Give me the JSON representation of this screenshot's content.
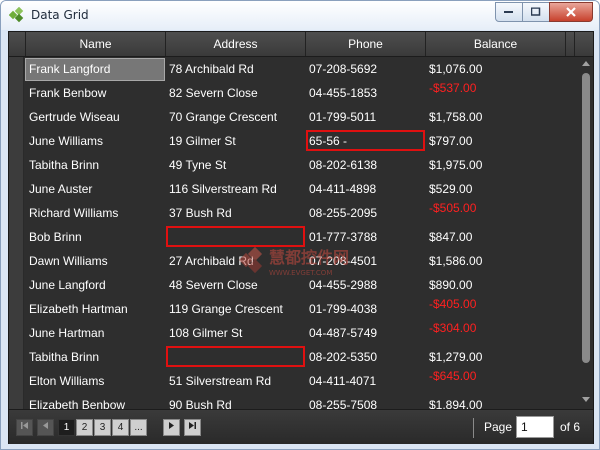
{
  "window": {
    "title": "Data Grid"
  },
  "grid": {
    "columns": [
      {
        "label": "Name"
      },
      {
        "label": "Address"
      },
      {
        "label": "Phone"
      },
      {
        "label": "Balance"
      }
    ],
    "rows": [
      {
        "name": "Frank Langford",
        "address": "78 Archibald Rd",
        "phone": "07-208-5692",
        "balance": "$1,076.00",
        "negative": false
      },
      {
        "name": "Frank Benbow",
        "address": "82 Severn Close",
        "phone": "04-455-1853",
        "balance": "-$537.00",
        "negative": true
      },
      {
        "name": "Gertrude Wiseau",
        "address": "70 Grange Crescent",
        "phone": "01-799-5011",
        "balance": "$1,758.00",
        "negative": false
      },
      {
        "name": "June Williams",
        "address": "19 Gilmer St",
        "phone": "65-56 -",
        "balance": "$797.00",
        "negative": false
      },
      {
        "name": "Tabitha Brinn",
        "address": "49 Tyne St",
        "phone": "08-202-6138",
        "balance": "$1,975.00",
        "negative": false
      },
      {
        "name": "June Auster",
        "address": "116 Silverstream Rd",
        "phone": "04-411-4898",
        "balance": "$529.00",
        "negative": false
      },
      {
        "name": "Richard Williams",
        "address": "37 Bush Rd",
        "phone": "08-255-2095",
        "balance": "-$505.00",
        "negative": true
      },
      {
        "name": "Bob Brinn",
        "address": "",
        "phone": "01-777-3788",
        "balance": "$847.00",
        "negative": false
      },
      {
        "name": "Dawn Williams",
        "address": "27 Archibald Rd",
        "phone": "07-208-4501",
        "balance": "$1,586.00",
        "negative": false
      },
      {
        "name": "June Langford",
        "address": "48 Severn Close",
        "phone": "04-455-2988",
        "balance": "$890.00",
        "negative": false
      },
      {
        "name": "Elizabeth Hartman",
        "address": "119 Grange Crescent",
        "phone": "01-799-4038",
        "balance": "-$405.00",
        "negative": true
      },
      {
        "name": "June Hartman",
        "address": "108 Gilmer St",
        "phone": "04-487-5749",
        "balance": "-$304.00",
        "negative": true
      },
      {
        "name": "Tabitha Brinn",
        "address": "",
        "phone": "08-202-5350",
        "balance": "$1,279.00",
        "negative": false
      },
      {
        "name": "Elton Williams",
        "address": "51 Silverstream Rd",
        "phone": "04-411-4071",
        "balance": "-$645.00",
        "negative": true
      },
      {
        "name": "Elizabeth Benbow",
        "address": "90 Bush Rd",
        "phone": "08-255-7508",
        "balance": "$1,894.00",
        "negative": false
      }
    ],
    "validation_errors": [
      {
        "row": 3,
        "column": "phone"
      },
      {
        "row": 7,
        "column": "address"
      },
      {
        "row": 12,
        "column": "address"
      }
    ],
    "selected": {
      "row": 0,
      "column": "name"
    }
  },
  "pager": {
    "pages": [
      "1",
      "2",
      "3",
      "4",
      "..."
    ],
    "current_page": "1",
    "page_label": "Page",
    "page_value": "1",
    "of_label": "of 6"
  },
  "watermark": {
    "text": "慧都控件网",
    "subtext": "WWW.EVGET.COM"
  },
  "colors": {
    "negative": "#ff2020",
    "error_border": "#e01010",
    "grid_bg": "#2e2e2e"
  }
}
